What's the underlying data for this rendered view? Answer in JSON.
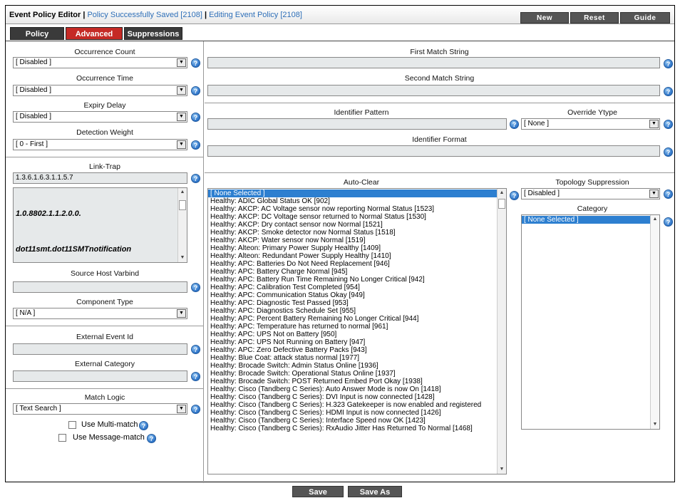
{
  "header": {
    "title": "Event Policy Editor",
    "status": "Policy Successfully Saved [2108]",
    "editing": "Editing Event Policy [2108]",
    "buttons": {
      "new": "New",
      "reset": "Reset",
      "guide": "Guide"
    }
  },
  "tabs": [
    {
      "label": "Policy"
    },
    {
      "label": "Advanced",
      "active": true
    },
    {
      "label": "Suppressions"
    }
  ],
  "left": {
    "occurrence_count": {
      "label": "Occurrence Count",
      "value": "[ Disabled ]"
    },
    "occurrence_time": {
      "label": "Occurrence Time",
      "value": "[ Disabled ]"
    },
    "expiry_delay": {
      "label": "Expiry Delay",
      "value": "[ Disabled ]"
    },
    "detection_weight": {
      "label": "Detection Weight",
      "value": "[ 0 - First ]"
    },
    "link_trap": {
      "label": "Link-Trap",
      "value": "1.3.6.1.6.3.1.1.5.7",
      "list": [
        "1.0.8802.1.1.2.0.0.",
        "dot11smt.dot11SMTnotification"
      ]
    },
    "source_host_varbind": {
      "label": "Source Host Varbind",
      "value": ""
    },
    "component_type": {
      "label": "Component Type",
      "value": "[ N/A ]"
    },
    "external_event_id": {
      "label": "External Event Id",
      "value": ""
    },
    "external_category": {
      "label": "External Category",
      "value": ""
    },
    "match_logic": {
      "label": "Match Logic",
      "value": "[ Text Search ]"
    },
    "use_multi_match": "Use Multi-match",
    "use_message_match": "Use Message-match"
  },
  "right": {
    "first_match_string": {
      "label": "First Match String",
      "value": ""
    },
    "second_match_string": {
      "label": "Second Match String",
      "value": ""
    },
    "identifier_pattern": {
      "label": "Identifier Pattern",
      "value": ""
    },
    "override_ytype": {
      "label": "Override Ytype",
      "value": "[ None ]"
    },
    "identifier_format": {
      "label": "Identifier Format",
      "value": ""
    },
    "auto_clear": {
      "label": "Auto-Clear",
      "items": [
        "[ None Selected ]",
        "Healthy: ADIC Global Status OK [902]",
        "Healthy: AKCP: AC Voltage sensor now reporting Normal Status [1523]",
        "Healthy: AKCP: DC Voltage sensor returned to Normal Status [1530]",
        "Healthy: AKCP: Dry contact sensor now Normal [1521]",
        "Healthy: AKCP: Smoke detector now Normal Status [1518]",
        "Healthy: AKCP: Water sensor now Normal [1519]",
        "Healthy: Alteon: Primary Power Supply Healthy [1409]",
        "Healthy: Alteon: Redundant Power Supply Healthy [1410]",
        "Healthy: APC: Batteries Do Not Need Replacement [946]",
        "Healthy: APC: Battery Charge Normal [945]",
        "Healthy: APC: Battery Run Time Remaining No Longer Critical [942]",
        "Healthy: APC: Calibration Test Completed [954]",
        "Healthy: APC: Communication Status Okay [949]",
        "Healthy: APC: Diagnostic Test Passed [953]",
        "Healthy: APC: Diagnostics Schedule Set [955]",
        "Healthy: APC: Percent Battery Remaining No Longer Critical [944]",
        "Healthy: APC: Temperature has returned to normal [961]",
        "Healthy: APC: UPS Not on Battery [950]",
        "Healthy: APC: UPS Not Running on Battery [947]",
        "Healthy: APC: Zero Defective Battery Packs [943]",
        "Healthy: Blue Coat: attack status normal [1977]",
        "Healthy: Brocade Switch: Admin Status Online [1936]",
        "Healthy: Brocade Switch: Operational Status Online [1937]",
        "Healthy: Brocade Switch: POST Returned Embed Port Okay [1938]",
        "Healthy: Cisco (Tandberg C Series): Auto Answer Mode is now On [1418]",
        "Healthy: Cisco (Tandberg C Series): DVI Input is now connected [1428]",
        "Healthy: Cisco (Tandberg C Series): H.323 Gatekeeper is now enabled and registered",
        "Healthy: Cisco (Tandberg C Series): HDMI Input is now connected [1426]",
        "Healthy: Cisco (Tandberg C Series): Interface Speed now OK [1423]",
        "Healthy: Cisco (Tandberg C Series): RxAudio Jitter Has Returned To Normal [1468]"
      ]
    },
    "topology_suppression": {
      "label": "Topology Suppression",
      "value": "[ Disabled ]"
    },
    "category": {
      "label": "Category",
      "items": [
        "[ None Selected ]"
      ]
    }
  },
  "footer": {
    "save": "Save",
    "save_as": "Save As"
  }
}
